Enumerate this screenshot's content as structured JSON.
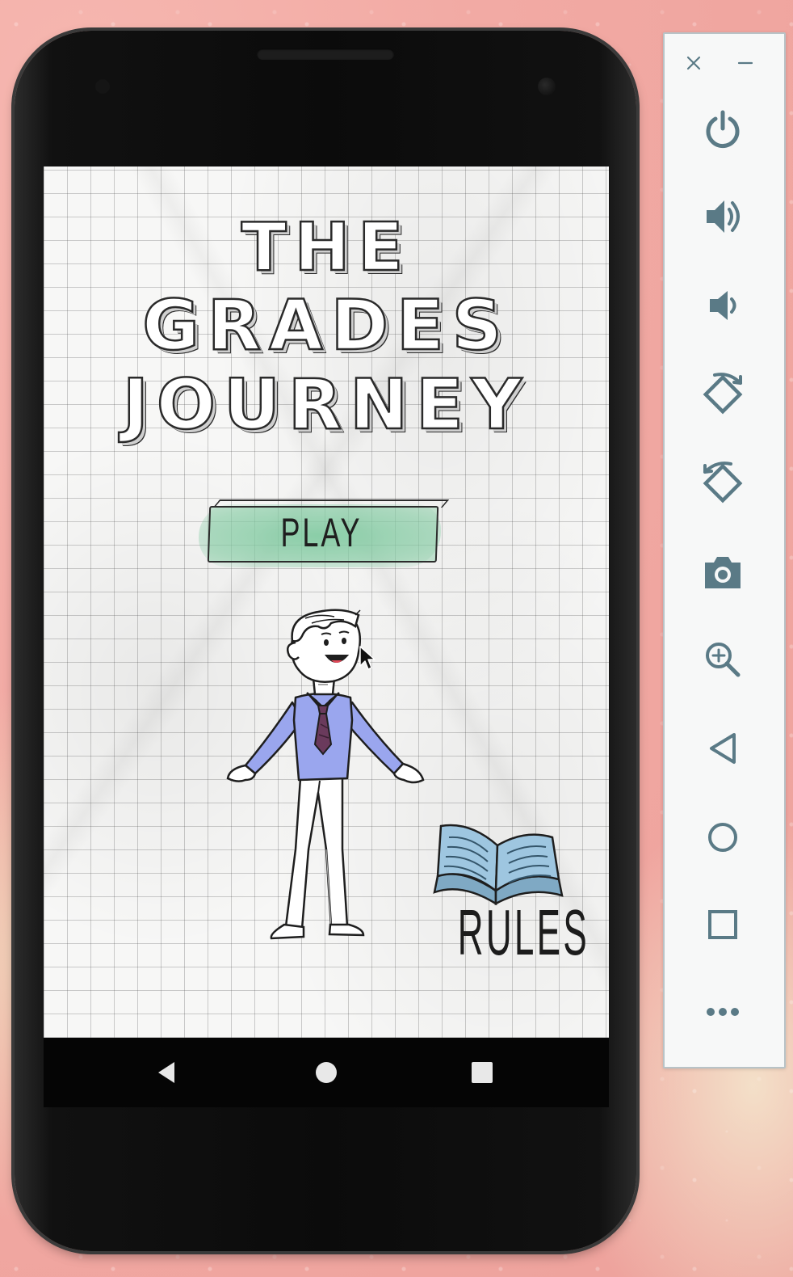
{
  "game": {
    "title_lines": [
      "THE",
      "GRADES",
      "JOURNEY"
    ],
    "play_label": "PLAY",
    "rules_label": "RULES"
  },
  "nav_bar": {
    "buttons": [
      "back-icon",
      "home-icon",
      "recent-apps-icon"
    ]
  },
  "emulator_toolbar": {
    "window_controls": [
      "close-icon",
      "minimize-icon"
    ],
    "buttons": [
      "power-icon",
      "volume-up-icon",
      "volume-down-icon",
      "rotate-left-icon",
      "rotate-right-icon",
      "camera-icon",
      "zoom-icon",
      "back-icon",
      "home-icon",
      "overview-icon",
      "more-icon"
    ],
    "icon_color": "#5a7a86"
  },
  "colors": {
    "play_button_fill": "#87cda5",
    "shirt": "#9aa6ee",
    "tie": "#6a3a5c",
    "book": "#9ec6e0",
    "desk_background": "#f0a8a2"
  }
}
